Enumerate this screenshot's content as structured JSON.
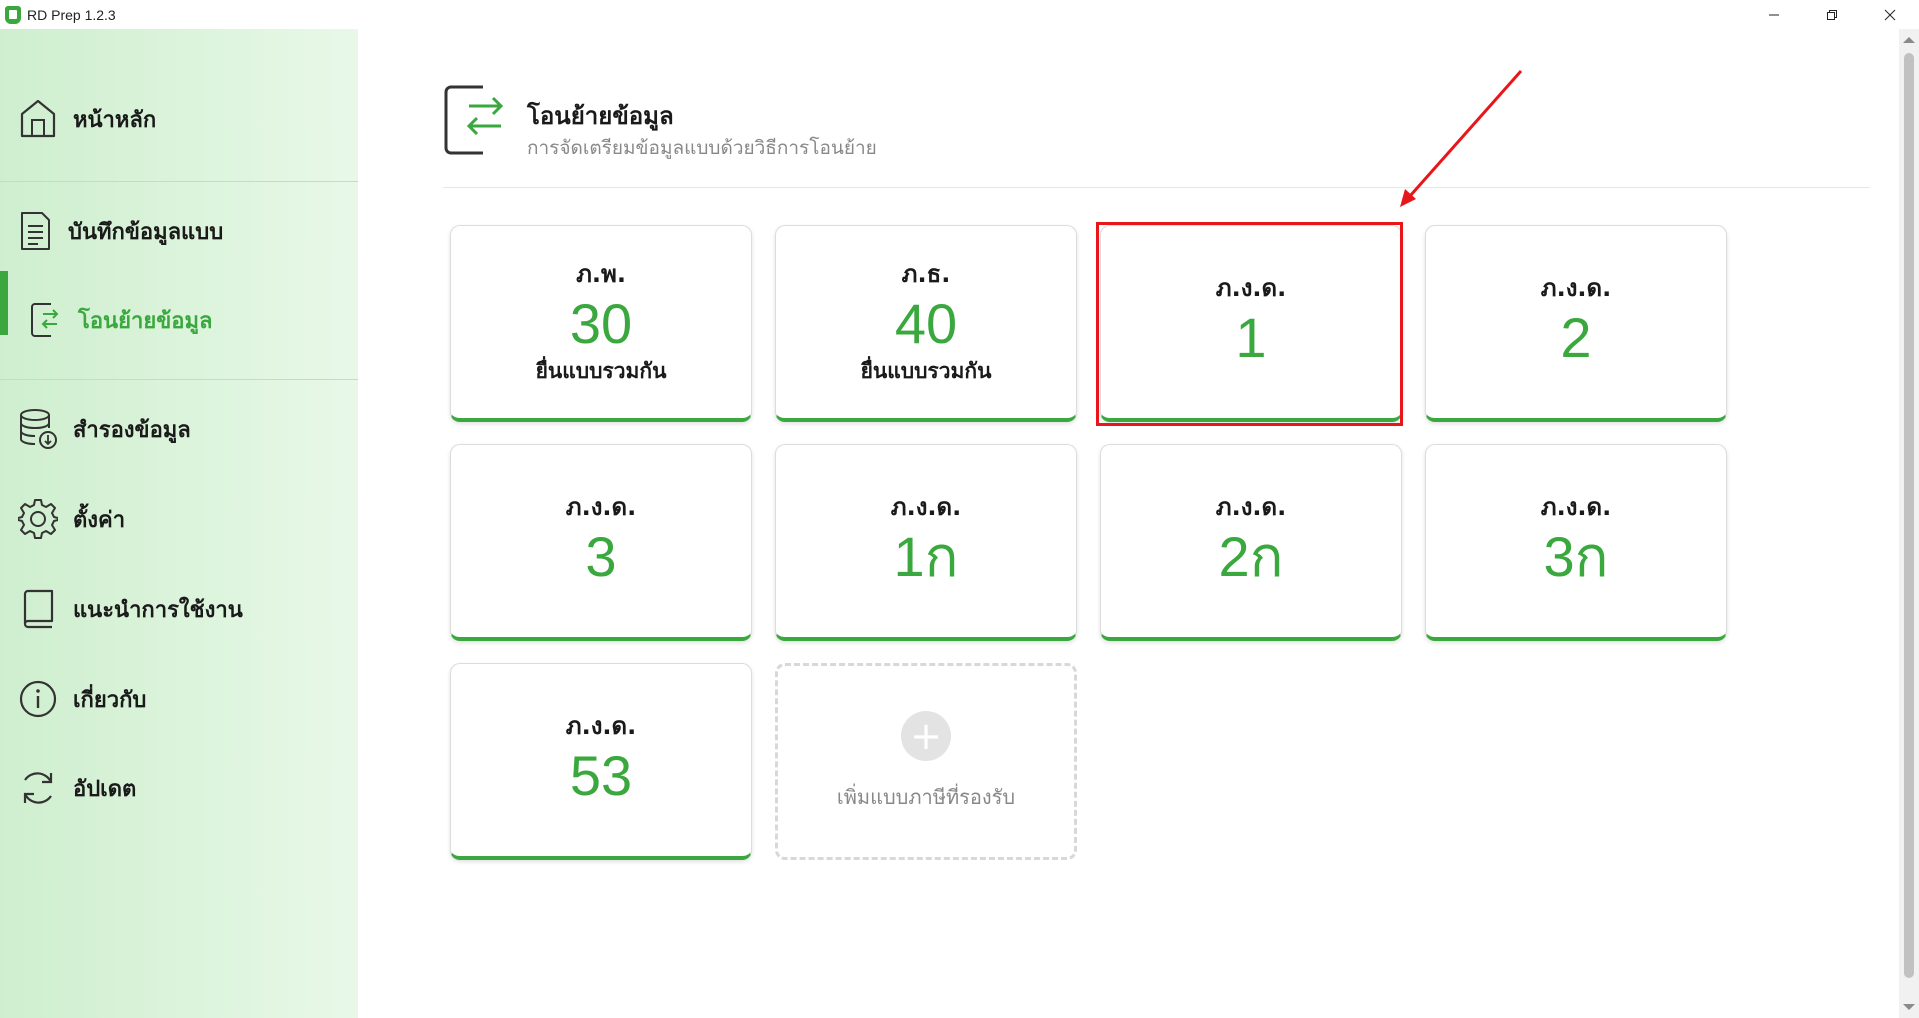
{
  "window": {
    "title": "RD Prep 1.2.3",
    "minimize": "—",
    "maximize": "❐",
    "close": "✕"
  },
  "sidebar": {
    "items": [
      {
        "label": "หน้าหลัก",
        "icon": "home-icon"
      },
      {
        "label": "บันทึกข้อมูลแบบ",
        "icon": "document-icon"
      },
      {
        "label": "โอนย้ายข้อมูล",
        "icon": "transfer-icon",
        "active": true
      },
      {
        "label": "สำรองข้อมูล",
        "icon": "database-icon"
      },
      {
        "label": "ตั้งค่า",
        "icon": "gear-icon"
      },
      {
        "label": "แนะนำการใช้งาน",
        "icon": "book-icon"
      },
      {
        "label": "เกี่ยวกับ",
        "icon": "info-icon"
      },
      {
        "label": "อัปเดต",
        "icon": "refresh-icon"
      }
    ]
  },
  "header": {
    "title": "โอนย้ายข้อมูล",
    "subtitle": "การจัดเตรียมข้อมูลแบบด้วยวิธีการโอนย้าย"
  },
  "cards": [
    {
      "name": "ภ.พ.",
      "number": "30",
      "desc": "ยื่นแบบรวมกัน"
    },
    {
      "name": "ภ.ธ.",
      "number": "40",
      "desc": "ยื่นแบบรวมกัน"
    },
    {
      "name": "ภ.ง.ด.",
      "number": "1"
    },
    {
      "name": "ภ.ง.ด.",
      "number": "2"
    },
    {
      "name": "ภ.ง.ด.",
      "number": "3"
    },
    {
      "name": "ภ.ง.ด.",
      "number": "1ก"
    },
    {
      "name": "ภ.ง.ด.",
      "number": "2ก"
    },
    {
      "name": "ภ.ง.ด.",
      "number": "3ก"
    },
    {
      "name": "ภ.ง.ด.",
      "number": "53"
    }
  ],
  "add_card": {
    "label": "เพิ่มแบบภาษีที่รองรับ",
    "icon": "plus-icon"
  },
  "colors": {
    "accent": "#3aa83e",
    "annotation": "#e8161b"
  }
}
